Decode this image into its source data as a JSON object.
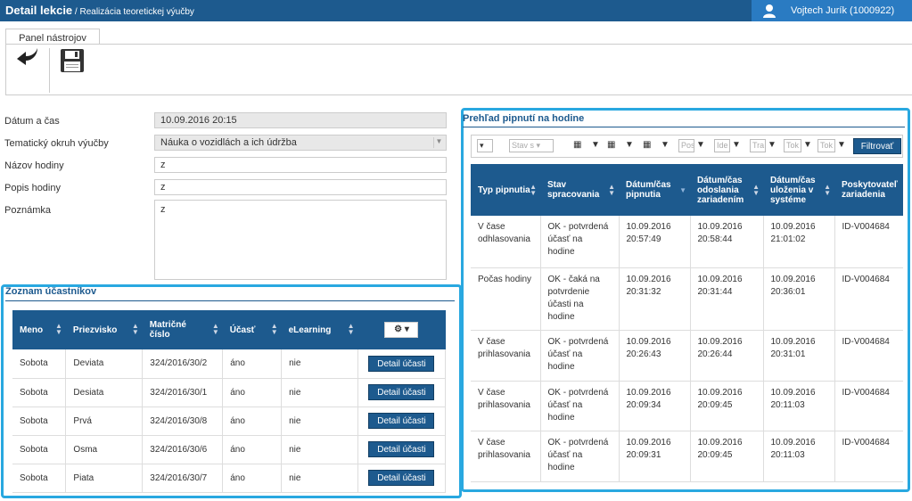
{
  "header": {
    "title": "Detail lekcie",
    "subtitle": " / Realizácia teoretickej výučby",
    "user": "Vojtech Jurík (1000922)"
  },
  "toolbar": {
    "tab_label": "Panel nástrojov",
    "back_icon": "back-arrow-icon",
    "save_icon": "floppy-disk-icon"
  },
  "form": {
    "datetime_label": "Dátum a čas",
    "datetime_value": "10.09.2016 20:15",
    "topic_label": "Tematický okruh výučby",
    "topic_value": "Náuka o vozidlách a ich údržba",
    "name_label": "Názov hodiny",
    "name_value": "z",
    "desc_label": "Popis hodiny",
    "desc_value": "z",
    "note_label": "Poznámka",
    "note_value": "z"
  },
  "participants": {
    "title": "Zoznam účastníkov",
    "headers": [
      "Meno",
      "Priezvisko",
      "Matričné číslo",
      "Účasť",
      "eLearning"
    ],
    "settings_icon": "gear-icon",
    "detail_label": "Detail účasti",
    "rows": [
      {
        "first": "Sobota",
        "last": "Deviata",
        "reg": "324/2016/30/2",
        "attend": "áno",
        "elearning": "nie"
      },
      {
        "first": "Sobota",
        "last": "Desiata",
        "reg": "324/2016/30/1",
        "attend": "áno",
        "elearning": "nie"
      },
      {
        "first": "Sobota",
        "last": "Prvá",
        "reg": "324/2016/30/8",
        "attend": "áno",
        "elearning": "nie"
      },
      {
        "first": "Sobota",
        "last": "Osma",
        "reg": "324/2016/30/6",
        "attend": "áno",
        "elearning": "nie"
      },
      {
        "first": "Sobota",
        "last": "Piata",
        "reg": "324/2016/30/7",
        "attend": "áno",
        "elearning": "nie"
      }
    ]
  },
  "history": {
    "title": "Prehľad pipnutí na hodine",
    "filter": {
      "state_placeholder": "Stav s",
      "pos_placeholder": "Pos",
      "ide_placeholder": "Ide",
      "tra_placeholder": "Tra",
      "tok1_placeholder": "Tok",
      "tok2_placeholder": "Tok",
      "filter_button": "Filtrovať"
    },
    "headers": [
      "Typ pipnutia",
      "Stav spracovania",
      "Dátum/čas pipnutia",
      "Dátum/čas odoslania zariadením",
      "Dátum/čas uloženia v systéme",
      "Poskytovateľ zariadenia"
    ],
    "rows": [
      {
        "type": "V čase odhlasovania",
        "state": "OK - potvrdená účasť na hodine",
        "pip": "10.09.2016 20:57:49",
        "sent": "10.09.2016 20:58:44",
        "saved": "10.09.2016 21:01:02",
        "provider": "ID-V004684"
      },
      {
        "type": "Počas hodiny",
        "state": "OK - čaká na potvrdenie účasti na hodine",
        "pip": "10.09.2016 20:31:32",
        "sent": "10.09.2016 20:31:44",
        "saved": "10.09.2016 20:36:01",
        "provider": "ID-V004684"
      },
      {
        "type": "V čase prihlasovania",
        "state": "OK - potvrdená účasť na hodine",
        "pip": "10.09.2016 20:26:43",
        "sent": "10.09.2016 20:26:44",
        "saved": "10.09.2016 20:31:01",
        "provider": "ID-V004684"
      },
      {
        "type": "V čase prihlasovania",
        "state": "OK - potvrdená účasť na hodine",
        "pip": "10.09.2016 20:09:34",
        "sent": "10.09.2016 20:09:45",
        "saved": "10.09.2016 20:11:03",
        "provider": "ID-V004684"
      },
      {
        "type": "V čase prihlasovania",
        "state": "OK - potvrdená účasť na hodine",
        "pip": "10.09.2016 20:09:31",
        "sent": "10.09.2016 20:09:45",
        "saved": "10.09.2016 20:11:03",
        "provider": "ID-V004684"
      }
    ]
  },
  "colors": {
    "primary": "#1d5a8e",
    "accent": "#2a7bc2",
    "highlight": "#29a8e0"
  }
}
